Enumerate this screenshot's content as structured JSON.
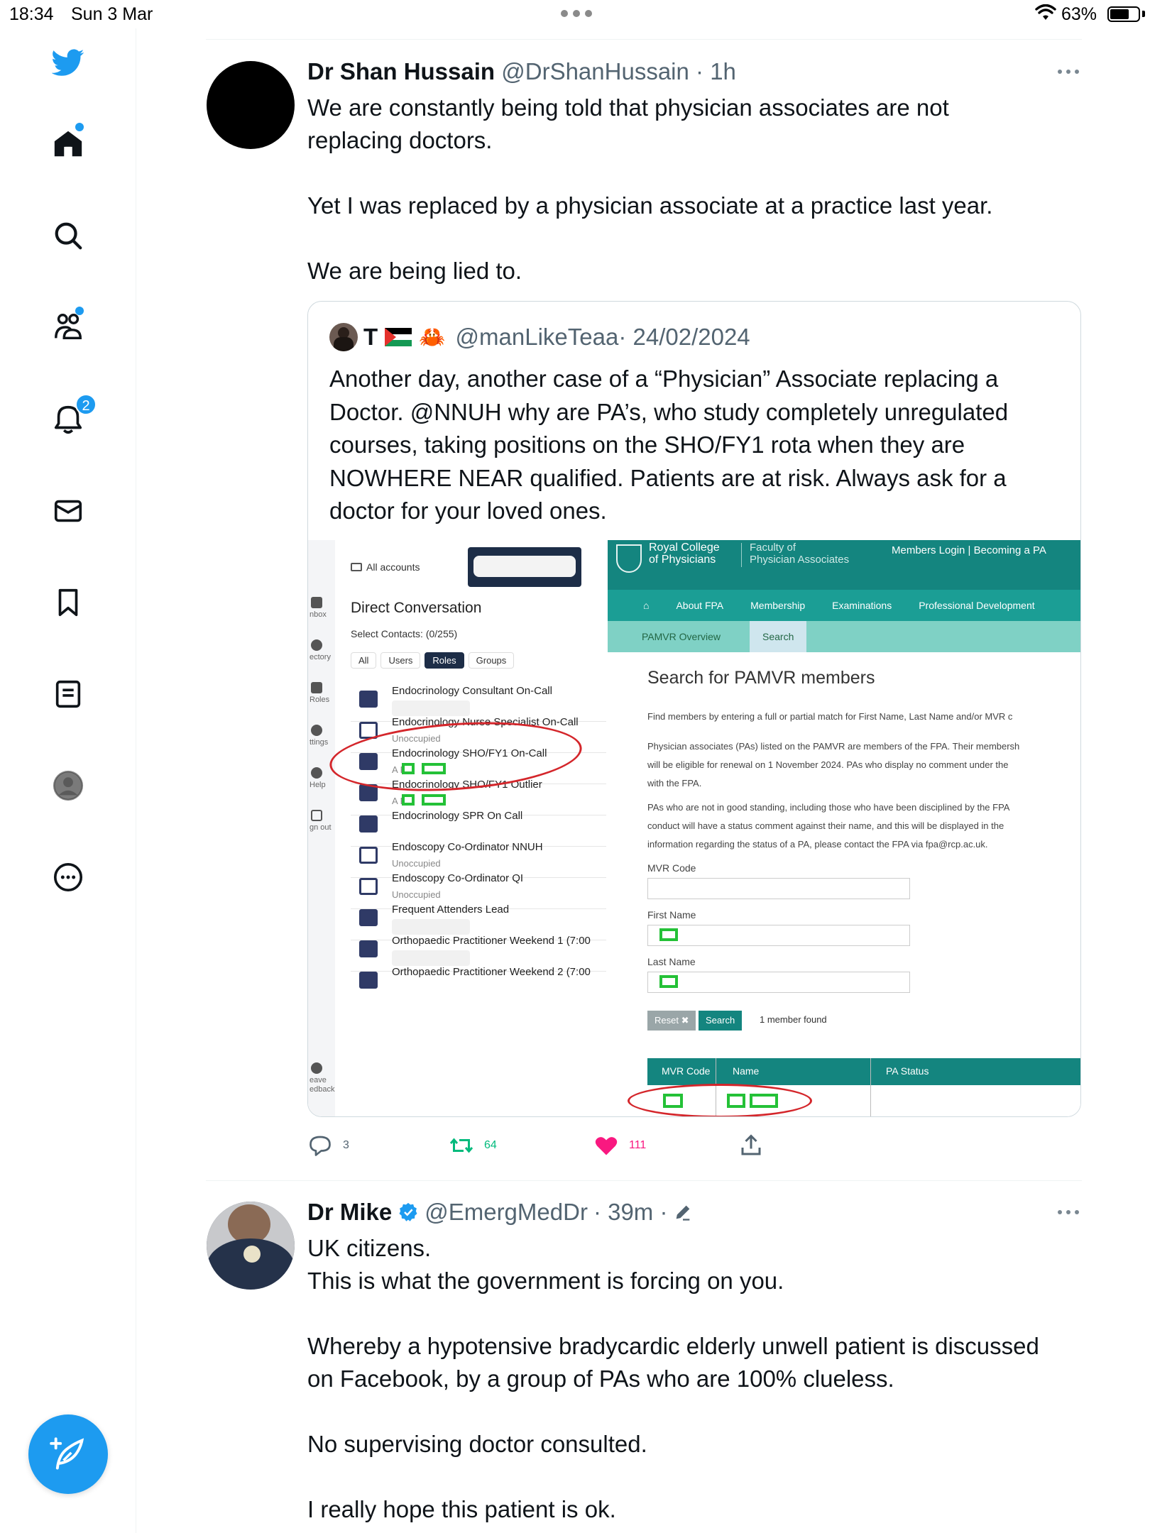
{
  "status_bar": {
    "time": "18:34",
    "date": "Sun 3 Mar",
    "battery": "63%"
  },
  "sidebar": {
    "items": [
      "twitter-logo",
      "home-icon",
      "search-icon",
      "communities-icon",
      "notifications-icon",
      "messages-icon",
      "bookmarks-icon",
      "lists-icon",
      "profile-icon",
      "more-icon"
    ],
    "notification_count": "2"
  },
  "tweets": [
    {
      "name": "Dr Shan Hussain",
      "handle": "@DrShanHussain",
      "time": "· 1h",
      "text": [
        "We are constantly being told that physician associates are not",
        "replacing doctors.",
        "",
        "Yet I was replaced by a physician associate at a practice last year.",
        "",
        "We are being lied to."
      ],
      "quote": {
        "name": "T",
        "handle": "@manLikeTeaa",
        "time": "· 24/02/2024",
        "text": [
          "Another day, another case of a “Physician” Associate replacing a",
          "Doctor. @NNUH why are PA’s, who study completely unregulated",
          "courses, taking positions on the SHO/FY1 rota when they are",
          "NOWHERE NEAR qualified. Patients are at risk. Always ask for a",
          "doctor for your loved ones."
        ],
        "media": {
          "app": {
            "rail": [
              "nbox",
              "ectory",
              "Roles",
              "ttings",
              "Help",
              "gn out",
              "eave\nedback"
            ],
            "accounts_label": "All accounts",
            "title": "Direct Conversation",
            "select_contacts": "Select Contacts: (0/255)",
            "filters": [
              "All",
              "Users",
              "Roles",
              "Groups"
            ],
            "roles": [
              {
                "name": "Endocrinology Consultant On-Call",
                "sub": ""
              },
              {
                "name": "Endocrinology Nurse Specialist On-Call",
                "sub": "Unoccupied"
              },
              {
                "name": "Endocrinology SHO/FY1 On-Call",
                "sub": "A F"
              },
              {
                "name": "Endocrinology SHO/FY1 Outlier",
                "sub": "A F"
              },
              {
                "name": "Endocrinology SPR On Call",
                "sub": ""
              },
              {
                "name": "Endoscopy Co-Ordinator NNUH",
                "sub": "Unoccupied"
              },
              {
                "name": "Endoscopy Co-Ordinator QI",
                "sub": "Unoccupied"
              },
              {
                "name": "Frequent Attenders Lead",
                "sub": ""
              },
              {
                "name": "Orthopaedic Practitioner Weekend 1 (7:00",
                "sub": ""
              },
              {
                "name": "Orthopaedic Practitioner Weekend 2 (7:00",
                "sub": ""
              }
            ]
          },
          "site": {
            "logo_line1": "Royal College",
            "logo_line2": "of Physicians",
            "logo_fac1": "Faculty of",
            "logo_fac2": "Physician Associates",
            "top_links": "Members Login   |   Becoming a PA",
            "nav": [
              "About FPA",
              "Membership",
              "Examinations",
              "Professional Development"
            ],
            "subtabs": [
              "PAMVR Overview",
              "Search"
            ],
            "heading": "Search for PAMVR members",
            "para1": "Find members by entering a full or partial match for First Name, Last Name and/or MVR c",
            "para2a": "Physician associates (PAs) listed on the PAMVR are members of the FPA. Their membersh",
            "para2b": "will be eligible for renewal on 1 November 2024. PAs who display no comment under the",
            "para2c": "with the FPA.",
            "para3a": "PAs who are not in good standing, including those who have been disciplined by the FPA",
            "para3b": "conduct will have a status comment against their name, and this will be displayed in the",
            "para3c": "information regarding the status of a PA, please contact the FPA via fpa@rcp.ac.uk.",
            "mvr_label": "MVR Code",
            "first_label": "First Name",
            "last_label": "Last Name",
            "reset": "Reset ✖",
            "search": "Search",
            "found": "1 member found",
            "col_mvr": "MVR Code",
            "col_name": "Name",
            "col_status": "PA Status"
          }
        }
      },
      "actions": {
        "replies": "3",
        "retweets": "64",
        "likes": "111"
      }
    },
    {
      "name": "Dr Mike",
      "handle": "@EmergMedDr",
      "time": "· 39m ·",
      "text": [
        "UK citizens.",
        "This is what the government is forcing on you.",
        "",
        "Whereby a hypotensive bradycardic elderly unwell patient is discussed",
        "on Facebook, by a group of PAs who are 100% clueless.",
        "",
        "No supervising doctor consulted.",
        "",
        "I really hope this patient is ok."
      ]
    }
  ],
  "colors": {
    "accent": "#1d9bf0",
    "retweet": "#00ba7c",
    "like": "#f91880",
    "teal": "#14857f"
  }
}
